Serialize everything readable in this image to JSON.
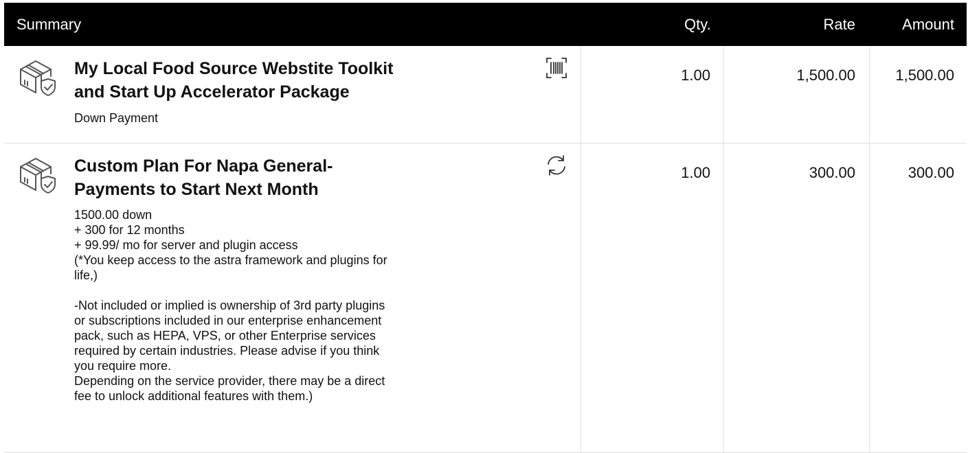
{
  "header": {
    "summary": "Summary",
    "qty": "Qty.",
    "rate": "Rate",
    "amount": "Amount"
  },
  "items": [
    {
      "title_line1": "My Local Food Source Webstite Toolkit",
      "title_line2": "and Start Up Accelerator Package",
      "description": "Down Payment",
      "side_icon": "barcode-icon",
      "item_icon": "package-shield-icon",
      "qty": "1.00",
      "rate": "1,500.00",
      "amount": "1,500.00"
    },
    {
      "title_line1": "Custom Plan For Napa General-",
      "title_line2": "Payments to Start Next Month",
      "description": "1500.00 down\n+ 300 for 12 months\n+ 99.99/ mo for server and plugin access\n(*You keep access to the astra framework and plugins for\nlife,)\n\n-Not included or implied is ownership of 3rd party plugins\nor subscriptions included in our enterprise enhancement\npack, such as HEPA, VPS, or other Enterprise services\nrequired by certain industries. Please advise if you think\nyou require more.\nDepending on the service provider, there may be a direct\nfee to unlock additional features with them.)",
      "side_icon": "recurring-icon",
      "item_icon": "package-shield-icon",
      "qty": "1.00",
      "rate": "300.00",
      "amount": "300.00"
    }
  ],
  "colors": {
    "header_bg": "#000000",
    "header_text": "#ffffff",
    "divider": "#dcdcdc"
  }
}
